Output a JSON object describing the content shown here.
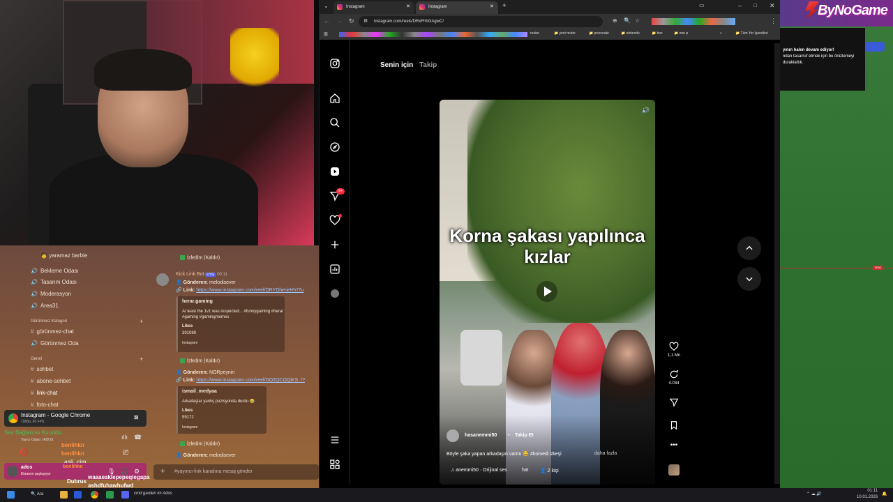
{
  "discord": {
    "channels_top": [
      {
        "label": "yaramaz barbie"
      },
      {
        "label": "Bekleme Odası"
      },
      {
        "label": "Tasarım Odası"
      },
      {
        "label": "Moderasyon"
      },
      {
        "label": "Area31"
      }
    ],
    "category_hidden": "Görünmez Kategori",
    "hidden_channels": [
      "görünmez-chat",
      "Görünmez Oda"
    ],
    "category_general": "Genel",
    "general_channels": [
      "sohbet",
      "abone-sohbet",
      "link-chat",
      "foto-chat"
    ],
    "messages": {
      "removed_1": "İzledim (Kaldır)",
      "bot_name": "Kick Link Bot",
      "bot_badge": "UYG",
      "bot_time": "00:11",
      "sender_label_1": "Gönderen:",
      "sender_1": "melodisever",
      "link_label_1": "Link:",
      "link_1": "https://www.instagram.com/reel/DRYDherjeHY/?u",
      "embed1_author": "herar.gaming",
      "embed1_text": "At least the 1v1 was respected... #funnygaming #herar #gaming #gamingmemes",
      "embed1_likes_label": "Likes",
      "embed1_likes": "391089",
      "embed1_footer": "Instagram",
      "removed_2": "İzledim (Kaldır)",
      "sender_label_2": "Gönderen:",
      "sender_2": "NORpeyniri",
      "link_label_2": "Link:",
      "link_2": "https://www.instagram.com/reel/DQ2QCQQjKS_/?",
      "embed2_author": "ismail_medyaa",
      "embed2_text": "Arkadaşlar yanlış pozisyonda durdu 😂",
      "embed2_likes_label": "Likes",
      "embed2_likes": "99172",
      "embed2_footer": "Instagram",
      "removed_3": "İzledim (Kaldır)",
      "sender_label_3": "Gönderen:",
      "sender_3": "melodisever"
    },
    "chat_placeholder": "#yayıncı-link kanalına mesaj gönder",
    "stream_window": "Instagram - Google Chrome",
    "stream_fps": "1080p, 60 FPS",
    "voice_status": "Ses Bağlantısı Kuruldu",
    "voice_channel": "Yayıcı Odası / ADOS",
    "overlay_names": [
      "benlihkn",
      "benlihkn",
      "asli_cim",
      "benlihkn"
    ],
    "overlay_msgs": [
      "Dubrus",
      "waaaeaklepepeqiegapa",
      "ashdfuhawhufwd"
    ],
    "user_name": "ados",
    "user_status": "Ekranını paylaşıyor"
  },
  "chrome": {
    "tabs": [
      {
        "title": "Instagram"
      },
      {
        "title": "Instagram"
      }
    ],
    "url": "instagram.com/reels/DRxFhhGAgwC/",
    "bookmarks": [
      "router",
      "yeni mutor",
      "procreate",
      "nintendo",
      "box",
      "one p",
      "Tüm Yer İşaretleri"
    ]
  },
  "instagram": {
    "tab_for_you": "Senin için",
    "tab_following": "Takip",
    "notif_count": "9+",
    "reel_caption": "Korna şakası yapılınca kızlar",
    "username": "hasanemmi50",
    "follow_label": "Takip Et",
    "description": "Böyle şaka yapan arkadaşın varmı 😂 #komedi #keşi",
    "more_label": "daha fazla",
    "audio": "anemmi50 · Orijinal ses",
    "audio2": "ha!",
    "people": "2 kişi",
    "likes": "1,1 Mn",
    "comments": "4.034"
  },
  "right_panel": {
    "logo": "ByNoGame",
    "popup_line1": "yının halen devam ediyor!",
    "popup_line2": "ndan tasarruf etmek için bu önizlemeyi duraklattık.",
    "tag": "YENİ"
  },
  "taskbar": {
    "search_label": "Ara",
    "time": "01:11",
    "date": "10.01.2026",
    "running": "cmd garden im Ados"
  },
  "colors": {
    "instagram_bg": "#000000",
    "discord_bg": "#8b5a3a",
    "link": "#9fc8ff",
    "right_bg": "#2f7030"
  }
}
